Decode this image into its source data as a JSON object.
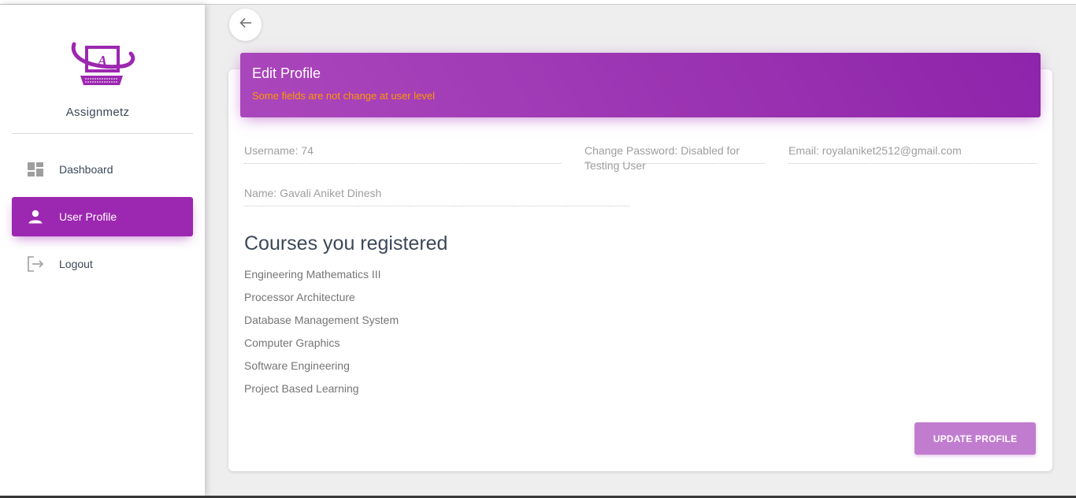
{
  "app": {
    "brand": "Assignmetz"
  },
  "sidebar": {
    "items": [
      {
        "label": "Dashboard",
        "icon": "dashboard-icon",
        "active": false
      },
      {
        "label": "User Profile",
        "icon": "person-icon",
        "active": true
      },
      {
        "label": "Logout",
        "icon": "logout-icon",
        "active": false
      }
    ]
  },
  "card": {
    "title": "Edit Profile",
    "subtitle": "Some fields are not change at user level"
  },
  "fields": {
    "username": "Username: 74",
    "password": "Change Password: Disabled for Testing User",
    "email": "Email: royalaniket2512@gmail.com",
    "name": "Name: Gavali Aniket Dinesh"
  },
  "courses": {
    "title": "Courses you registered",
    "items": [
      "Engineering Mathematics III",
      "Processor Architecture",
      "Database Management System",
      "Computer Graphics",
      "Software Engineering",
      "Project Based Learning"
    ]
  },
  "actions": {
    "update_label": "UPDATE PROFILE"
  },
  "colors": {
    "accent": "#9c27b0",
    "header_gradient_start": "#ab47bc",
    "header_gradient_end": "#8e24aa",
    "warning_text": "#ff9800",
    "update_button": "#c17ccf"
  }
}
